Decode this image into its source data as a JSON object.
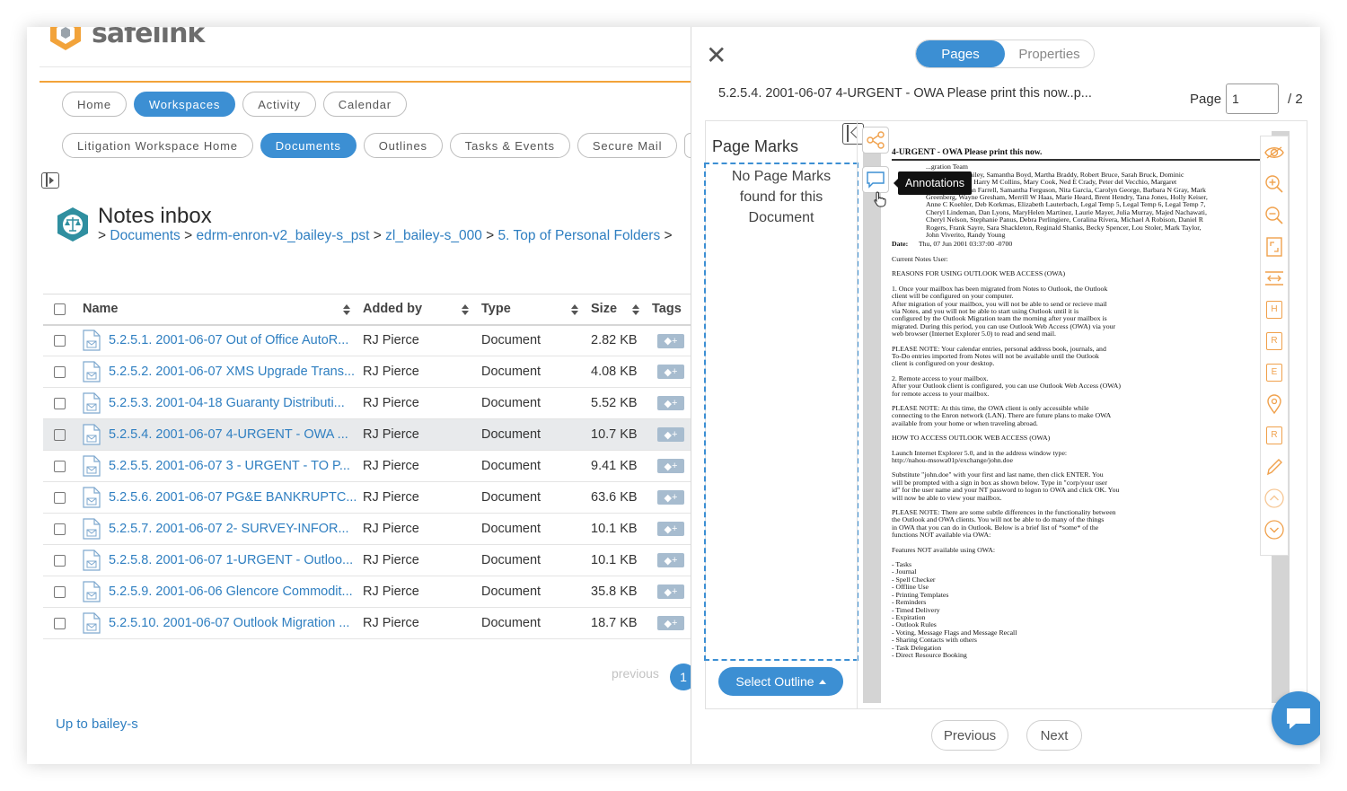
{
  "app": {
    "logo_text": "safelink"
  },
  "nav_main": [
    {
      "label": "Home",
      "active": false
    },
    {
      "label": "Workspaces",
      "active": true
    },
    {
      "label": "Activity",
      "active": false
    },
    {
      "label": "Calendar",
      "active": false
    }
  ],
  "nav_sub": [
    {
      "label": "Litigation Workspace Home",
      "active": false
    },
    {
      "label": "Documents",
      "active": true
    },
    {
      "label": "Outlines",
      "active": false
    },
    {
      "label": "Tasks & Events",
      "active": false
    },
    {
      "label": "Secure Mail",
      "active": false
    }
  ],
  "page": {
    "title": "Notes inbox",
    "breadcrumb": [
      {
        "sep": ">",
        "label": "Documents"
      },
      {
        "sep": ">",
        "label": "edrm-enron-v2_bailey-s_pst"
      },
      {
        "sep": ">",
        "label": "zl_bailey-s_000"
      },
      {
        "sep": ">",
        "label": "5. Top of Personal Folders"
      },
      {
        "sep": ">",
        "label": ""
      }
    ]
  },
  "table": {
    "columns": [
      "Name",
      "Added by",
      "Type",
      "Size",
      "Tags"
    ],
    "rows": [
      {
        "name": "5.2.5.1. 2001-06-07 Out of Office AutoR...",
        "added_by": "RJ Pierce",
        "type": "Document",
        "size": "2.82 KB",
        "selected": false
      },
      {
        "name": "5.2.5.2. 2001-06-07 XMS Upgrade Trans...",
        "added_by": "RJ Pierce",
        "type": "Document",
        "size": "4.08 KB",
        "selected": false
      },
      {
        "name": "5.2.5.3. 2001-04-18 Guaranty Distributi...",
        "added_by": "RJ Pierce",
        "type": "Document",
        "size": "5.52 KB",
        "selected": false
      },
      {
        "name": "5.2.5.4. 2001-06-07 4-URGENT - OWA ...",
        "added_by": "RJ Pierce",
        "type": "Document",
        "size": "10.7 KB",
        "selected": true
      },
      {
        "name": "5.2.5.5. 2001-06-07 3 - URGENT - TO P...",
        "added_by": "RJ Pierce",
        "type": "Document",
        "size": "9.41 KB",
        "selected": false
      },
      {
        "name": "5.2.5.6. 2001-06-07 PG&E BANKRUPTC...",
        "added_by": "RJ Pierce",
        "type": "Document",
        "size": "63.6 KB",
        "selected": false
      },
      {
        "name": "5.2.5.7. 2001-06-07 2- SURVEY-INFOR...",
        "added_by": "RJ Pierce",
        "type": "Document",
        "size": "10.1 KB",
        "selected": false
      },
      {
        "name": "5.2.5.8. 2001-06-07 1-URGENT - Outloo...",
        "added_by": "RJ Pierce",
        "type": "Document",
        "size": "10.1 KB",
        "selected": false
      },
      {
        "name": "5.2.5.9. 2001-06-06 Glencore Commodit...",
        "added_by": "RJ Pierce",
        "type": "Document",
        "size": "35.8 KB",
        "selected": false
      },
      {
        "name": "5.2.5.10. 2001-06-07 Outlook Migration ...",
        "added_by": "RJ Pierce",
        "type": "Document",
        "size": "18.7 KB",
        "selected": false
      }
    ],
    "tag_add": "+"
  },
  "pagination": {
    "previous": "previous",
    "current": "1"
  },
  "up_link": "Up to bailey-s",
  "viewer": {
    "close": "✕",
    "tabs": [
      {
        "label": "Pages",
        "active": true
      },
      {
        "label": "Properties",
        "active": false
      }
    ],
    "doc_title": "5.2.5.4. 2001-06-07 4-URGENT - OWA Please print this now..p...",
    "page_label": "Page",
    "page_value": "1",
    "page_total": "/ 2",
    "page_marks_title": "Page Marks",
    "page_marks_empty": "No Page Marks found for this Document",
    "select_outline": "Select Outline",
    "tooltip": "Annotations",
    "prev_btn": "Previous",
    "next_btn": "Next",
    "colors": {
      "accent": "#3c8fd3",
      "tool": "#f0a14c"
    },
    "right_tools": [
      "eye-icon",
      "zoom-in-icon",
      "zoom-out-icon",
      "fit-page-icon",
      "fit-width-icon",
      "H",
      "R",
      "E",
      "pin-icon",
      "R",
      "pencil-icon",
      "chevron-up-icon",
      "chevron-down-icon"
    ]
  },
  "document": {
    "heading": "4-URGENT - OWA Please print this now.",
    "header_rows": [
      "...gration Team",
      "...witz, Susan Bailey, Samantha Boyd, Martha Braddy, Robert Bruce, Sarah Bruck, Dominic",
      "...onnie Castillo, Harry M Collins, Mary Cook, Ned E Crady, Peter del Vecchio, Margaret",
      "Doucette, Keegan Farrell, Samantha Ferguson, Nita Garcia, Carolyn George, Barbara N Gray, Mark",
      "Greenberg, Wayne Gresham, Merrill W Haas, Marie Heard, Brent Hendry, Tana Jones, Holly Keiser,",
      "Anne C Koehler, Deb Korkmas, Elizabeth Lauterbach, Legal Temp 5, Legal Temp 6, Legal Temp 7,",
      "Cheryl Lindeman, Dan Lyons, MaryHelen Martinez, Laurie Mayer, Julia Murray, Majed Nachawati,",
      "Cheryl Nelson, Stephanie Panus, Debra Perlingiere, Coralina Rivera, Michael A Robison, Daniel R",
      "Rogers, Frank Sayre, Sara Shackleton, Reginald Shanks, Becky Spencer, Lou Stoler, Mark Taylor,",
      "John Viverito, Randy Young"
    ],
    "date_label": "Date:",
    "date_value": "Thu, 07 Jun 2001 03:37:00 -0700",
    "paragraphs": [
      "Current Notes User:",
      "REASONS FOR USING OUTLOOK WEB ACCESS (OWA)",
      "1. Once your mailbox has been migrated from Notes to Outlook, the Outlook\nclient will be configured on your computer.\nAfter migration of your mailbox, you will not be able to send or recieve mail\nvia Notes, and you will not be able to start using Outlook until it is\nconfigured by the Outlook Migration team the morning after your mailbox is\nmigrated. During this period, you can use Outlook Web Access (OWA) via your\nweb browser (Internet Explorer 5.0) to read and send mail.",
      "PLEASE NOTE: Your calendar entries, personal address book, journals, and\nTo-Do entries imported from Notes will not be available until the Outlook\nclient is configured on your desktop.",
      "2. Remote access to your mailbox.\nAfter your Outlook client is configured, you can use Outlook Web Access (OWA)\nfor remote access to your mailbox.",
      "PLEASE NOTE: At this time, the OWA client is only accessible while\nconnecting to the Enron network (LAN). There are future plans to make OWA\navailable from your home or when traveling abroad.",
      "HOW TO ACCESS OUTLOOK WEB ACCESS (OWA)",
      "Launch Internet Explorer 5.0, and in the address window type:\nhttp://nahou-msowa01p/exchange/john.doe",
      "Substitute \"john.doe\" with your first and last name, then click ENTER. You\nwill be prompted with a sign in box as shown below. Type in \"corp/your user\nid\" for the user name and your NT password to logon to OWA and click OK. You\nwill now be able to view your mailbox.",
      "PLEASE NOTE: There are some subtle differences in the functionality between\nthe Outlook and OWA clients. You will not be able to do many of the things\nin OWA that you can do in Outlook. Below is a brief list of *some* of the\nfunctions NOT available via OWA:",
      "Features NOT available using OWA:",
      "- Tasks\n- Journal\n- Spell Checker\n- Offline Use\n- Printing Templates\n- Reminders\n- Timed Delivery\n- Expiration\n- Outlook Rules\n- Voting, Message Flags and Message Recall\n- Sharing Contacts with others\n- Task Delegation\n- Direct Resource Booking"
    ]
  }
}
